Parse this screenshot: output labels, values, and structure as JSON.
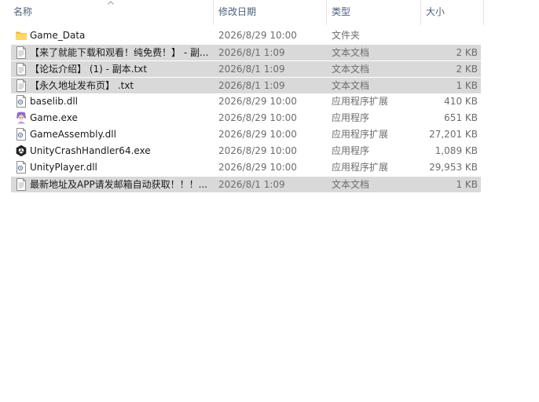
{
  "columns": {
    "name": "名称",
    "date": "修改日期",
    "type": "类型",
    "size": "大小"
  },
  "files": [
    {
      "name": "Game_Data",
      "date": "2026/8/29 10:00",
      "type": "文件夹",
      "size": "",
      "icon": "folder-icon",
      "selected": false
    },
    {
      "name": "【来了就能下载和观看！纯免费！】 - 副...",
      "date": "2026/8/1 1:09",
      "type": "文本文档",
      "size": "2 KB",
      "icon": "text-document-icon",
      "selected": true
    },
    {
      "name": "【论坛介绍】 (1) - 副本.txt",
      "date": "2026/8/1 1:09",
      "type": "文本文档",
      "size": "2 KB",
      "icon": "text-document-icon",
      "selected": true
    },
    {
      "name": "【永久地址发布页】 .txt",
      "date": "2026/8/1 1:09",
      "type": "文本文档",
      "size": "1 KB",
      "icon": "text-document-icon",
      "selected": true
    },
    {
      "name": "baselib.dll",
      "date": "2026/8/29 10:00",
      "type": "应用程序扩展",
      "size": "410 KB",
      "icon": "dll-file-icon",
      "selected": false
    },
    {
      "name": "Game.exe",
      "date": "2026/8/29 10:00",
      "type": "应用程序",
      "size": "651 KB",
      "icon": "game-app-icon",
      "selected": false
    },
    {
      "name": "GameAssembly.dll",
      "date": "2026/8/29 10:00",
      "type": "应用程序扩展",
      "size": "27,201 KB",
      "icon": "dll-file-icon",
      "selected": false
    },
    {
      "name": "UnityCrashHandler64.exe",
      "date": "2026/8/29 10:00",
      "type": "应用程序",
      "size": "1,089 KB",
      "icon": "unity-logo-icon",
      "selected": false
    },
    {
      "name": "UnityPlayer.dll",
      "date": "2026/8/29 10:00",
      "type": "应用程序扩展",
      "size": "29,953 KB",
      "icon": "dll-file-icon",
      "selected": false
    },
    {
      "name": "最新地址及APP请发邮箱自动获取！！！...",
      "date": "2026/8/1 1:09",
      "type": "文本文档",
      "size": "1 KB",
      "icon": "text-document-icon",
      "selected": true
    }
  ]
}
